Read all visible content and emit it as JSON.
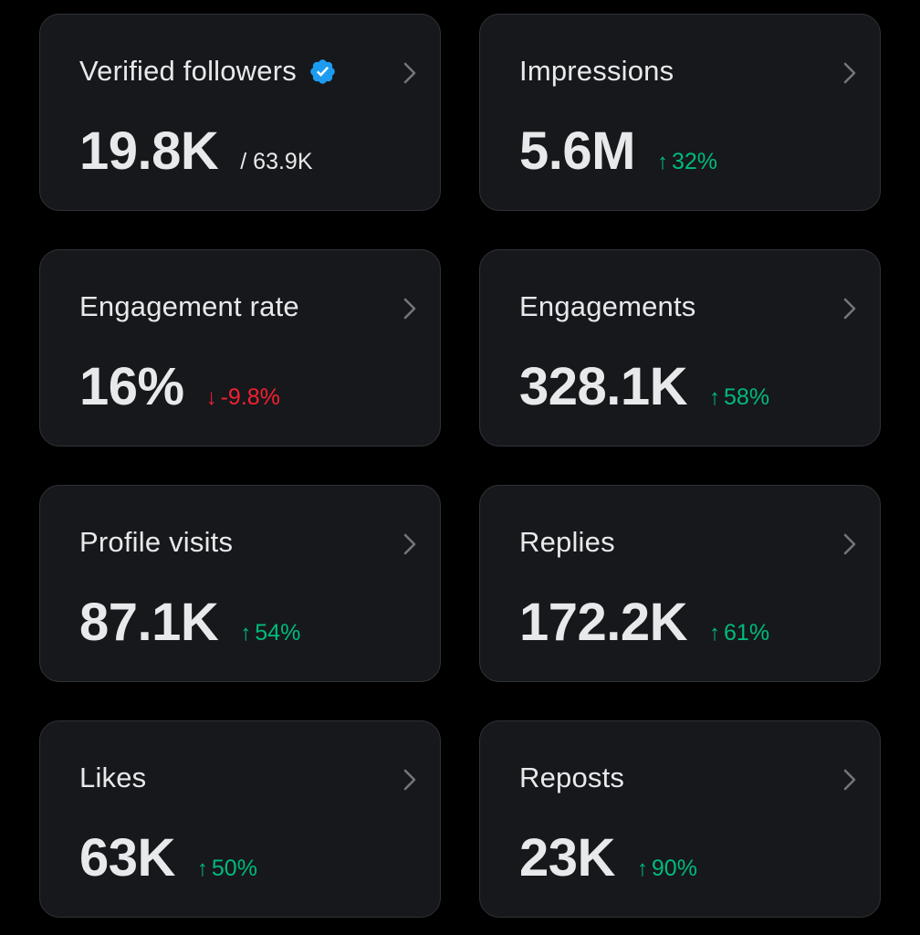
{
  "colors": {
    "background": "#000000",
    "card_background": "#16181c",
    "card_border": "#2f3336",
    "text_primary": "#e7e9ea",
    "positive": "#00ba7c",
    "negative": "#f4212e",
    "verified_badge": "#1d9bf0"
  },
  "cards": [
    {
      "title": "Verified followers",
      "value": "19.8K",
      "sub_total": "/ 63.9K",
      "icon": "verified-badge-icon",
      "chevron": "chevron-right-icon"
    },
    {
      "title": "Impressions",
      "value": "5.6M",
      "change": {
        "direction": "up",
        "arrow": "↑",
        "text": "32%"
      },
      "chevron": "chevron-right-icon"
    },
    {
      "title": "Engagement rate",
      "value": "16%",
      "change": {
        "direction": "down",
        "arrow": "↓",
        "text": "-9.8%"
      },
      "chevron": "chevron-right-icon"
    },
    {
      "title": "Engagements",
      "value": "328.1K",
      "change": {
        "direction": "up",
        "arrow": "↑",
        "text": "58%"
      },
      "chevron": "chevron-right-icon"
    },
    {
      "title": "Profile visits",
      "value": "87.1K",
      "change": {
        "direction": "up",
        "arrow": "↑",
        "text": "54%"
      },
      "chevron": "chevron-right-icon"
    },
    {
      "title": "Replies",
      "value": "172.2K",
      "change": {
        "direction": "up",
        "arrow": "↑",
        "text": "61%"
      },
      "chevron": "chevron-right-icon"
    },
    {
      "title": "Likes",
      "value": "63K",
      "change": {
        "direction": "up",
        "arrow": "↑",
        "text": "50%"
      },
      "chevron": "chevron-right-icon"
    },
    {
      "title": "Reposts",
      "value": "23K",
      "change": {
        "direction": "up",
        "arrow": "↑",
        "text": "90%"
      },
      "chevron": "chevron-right-icon"
    }
  ]
}
